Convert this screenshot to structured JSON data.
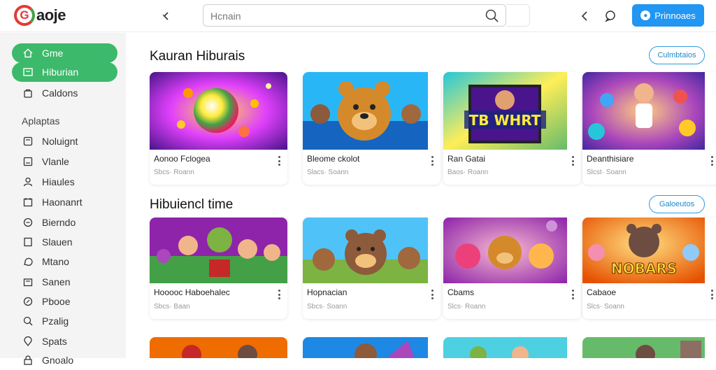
{
  "header": {
    "logo_text": "aoje",
    "logo_mark": "G",
    "search_placeholder": "Hcnain",
    "signin_label": "Prinnoaes"
  },
  "sidebar": {
    "top_items": [
      {
        "label": "Gme",
        "icon": "home-icon"
      },
      {
        "label": "Hiburian",
        "icon": "tv-icon"
      },
      {
        "label": "Caldons",
        "icon": "bag-icon"
      }
    ],
    "heading": "Aplaptas",
    "items": [
      {
        "label": "Noluignt",
        "icon": "square-icon"
      },
      {
        "label": "Vlanle",
        "icon": "window-icon"
      },
      {
        "label": "Hiaules",
        "icon": "person-icon"
      },
      {
        "label": "Haonanrt",
        "icon": "calendar-icon"
      },
      {
        "label": "Bierndo",
        "icon": "chat-icon"
      },
      {
        "label": "Slauen",
        "icon": "doc-icon"
      },
      {
        "label": "Mtano",
        "icon": "bubble-icon"
      },
      {
        "label": "Sanen",
        "icon": "folder-icon"
      },
      {
        "label": "Pbooe",
        "icon": "badge-icon"
      },
      {
        "label": "Pzalig",
        "icon": "search-person-icon"
      },
      {
        "label": "Spats",
        "icon": "pin-icon"
      },
      {
        "label": "Gnoalo",
        "icon": "lock-icon"
      }
    ]
  },
  "sections": [
    {
      "title": "Kauran Hiburais",
      "see_all": "Culmbtaios",
      "cards": [
        {
          "title": "Aonoo Fclogea",
          "meta": "Sbcs· Roann"
        },
        {
          "title": "Bleome ckolot",
          "meta": "Slacs· Soann"
        },
        {
          "title": "Ran Gatai",
          "meta": "Baos· Roann"
        },
        {
          "title": "Deanthisiare",
          "meta": "Slcst· Soann"
        }
      ]
    },
    {
      "title": "Hibuiencl time",
      "see_all": "Galoeutos",
      "cards": [
        {
          "title": "Hooooc Haboehalec",
          "meta": "Sbcs· Baan"
        },
        {
          "title": "Hopnacian",
          "meta": "Sbcs· Soann"
        },
        {
          "title": "Cbams",
          "meta": "Slcs· Roann"
        },
        {
          "title": "Cabaoe",
          "meta": "Slcs· Soann"
        }
      ]
    }
  ],
  "thumb_banner_text": [
    "TB WHRT",
    "NOBARS"
  ],
  "colors": {
    "accent_green": "#3cb96a",
    "primary_blue": "#2196f3",
    "sidebar_bg": "#f3f4f3"
  }
}
